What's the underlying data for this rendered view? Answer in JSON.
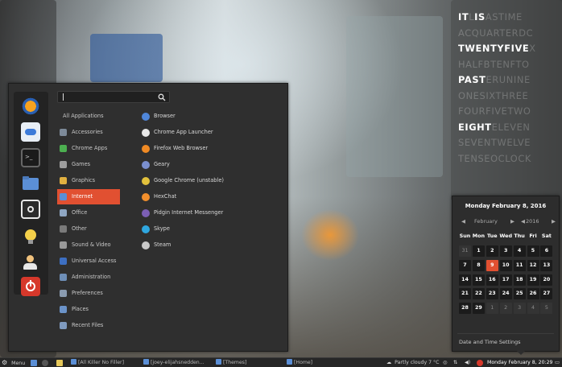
{
  "word_clock": {
    "rows": [
      [
        {
          "t": "IT",
          "on": true
        },
        {
          "t": "L",
          "on": false
        },
        {
          "t": "IS",
          "on": true
        },
        {
          "t": "ASTIME",
          "on": false
        }
      ],
      [
        {
          "t": "ACQUARTERDC",
          "on": false
        }
      ],
      [
        {
          "t": "TWENTYFIVE",
          "on": true
        },
        {
          "t": "X",
          "on": false
        }
      ],
      [
        {
          "t": "HALFBTENFTO",
          "on": false
        }
      ],
      [
        {
          "t": "PAST",
          "on": true
        },
        {
          "t": "ERUNINE",
          "on": false
        }
      ],
      [
        {
          "t": "ONESIXTHREE",
          "on": false
        }
      ],
      [
        {
          "t": "FOURFIVETWO",
          "on": false
        }
      ],
      [
        {
          "t": "EIGHT",
          "on": true
        },
        {
          "t": "ELEVEN",
          "on": false
        }
      ],
      [
        {
          "t": "SEVENTWELVE",
          "on": false
        }
      ],
      [
        {
          "t": "TENSEOCLOCK",
          "on": false
        }
      ]
    ]
  },
  "menu": {
    "search_placeholder": "",
    "favorites": [
      "firefox-icon",
      "settings-toggle-icon",
      "terminal-icon",
      "files-icon",
      "screenshot-icon",
      "lightbulb-icon",
      "user-logout-icon",
      "power-icon"
    ],
    "categories": [
      {
        "label": "All Applications",
        "icon": "none"
      },
      {
        "label": "Accessories",
        "icon": "accessories-icon"
      },
      {
        "label": "Chrome Apps",
        "icon": "chrome-apps-icon"
      },
      {
        "label": "Games",
        "icon": "games-icon"
      },
      {
        "label": "Graphics",
        "icon": "graphics-icon"
      },
      {
        "label": "Internet",
        "icon": "internet-icon"
      },
      {
        "label": "Office",
        "icon": "office-icon"
      },
      {
        "label": "Other",
        "icon": "other-icon"
      },
      {
        "label": "Sound & Video",
        "icon": "sound-video-icon"
      },
      {
        "label": "Universal Access",
        "icon": "universal-access-icon"
      },
      {
        "label": "Administration",
        "icon": "administration-icon"
      },
      {
        "label": "Preferences",
        "icon": "preferences-icon"
      },
      {
        "label": "Places",
        "icon": "places-icon"
      },
      {
        "label": "Recent Files",
        "icon": "recent-files-icon"
      }
    ],
    "selected_category": "Internet",
    "apps": [
      {
        "label": "Browser",
        "icon": "browser-icon"
      },
      {
        "label": "Chrome App Launcher",
        "icon": "chrome-app-launcher-icon"
      },
      {
        "label": "Firefox Web Browser",
        "icon": "firefox-icon"
      },
      {
        "label": "Geary",
        "icon": "geary-icon"
      },
      {
        "label": "Google Chrome (unstable)",
        "icon": "google-chrome-icon"
      },
      {
        "label": "HexChat",
        "icon": "hexchat-icon"
      },
      {
        "label": "Pidgin Internet Messenger",
        "icon": "pidgin-icon"
      },
      {
        "label": "Skype",
        "icon": "skype-icon"
      },
      {
        "label": "Steam",
        "icon": "steam-icon"
      }
    ]
  },
  "calendar": {
    "title": "Monday February  8, 2016",
    "month": "February",
    "year": "2016",
    "weekdays": [
      "Sun",
      "Mon",
      "Tue",
      "Wed",
      "Thu",
      "Fri",
      "Sat"
    ],
    "weeks": [
      [
        {
          "d": "31",
          "m": "o"
        },
        {
          "d": "1",
          "m": "c"
        },
        {
          "d": "2",
          "m": "c"
        },
        {
          "d": "3",
          "m": "c"
        },
        {
          "d": "4",
          "m": "c"
        },
        {
          "d": "5",
          "m": "c"
        },
        {
          "d": "6",
          "m": "c"
        }
      ],
      [
        {
          "d": "7",
          "m": "c"
        },
        {
          "d": "8",
          "m": "c"
        },
        {
          "d": "9",
          "m": "t"
        },
        {
          "d": "10",
          "m": "c"
        },
        {
          "d": "11",
          "m": "c"
        },
        {
          "d": "12",
          "m": "c"
        },
        {
          "d": "13",
          "m": "c"
        }
      ],
      [
        {
          "d": "14",
          "m": "c"
        },
        {
          "d": "15",
          "m": "c"
        },
        {
          "d": "16",
          "m": "c"
        },
        {
          "d": "17",
          "m": "c"
        },
        {
          "d": "18",
          "m": "c"
        },
        {
          "d": "19",
          "m": "c"
        },
        {
          "d": "20",
          "m": "c"
        }
      ],
      [
        {
          "d": "21",
          "m": "c"
        },
        {
          "d": "22",
          "m": "c"
        },
        {
          "d": "23",
          "m": "c"
        },
        {
          "d": "24",
          "m": "c"
        },
        {
          "d": "25",
          "m": "c"
        },
        {
          "d": "26",
          "m": "c"
        },
        {
          "d": "27",
          "m": "c"
        }
      ],
      [
        {
          "d": "28",
          "m": "c"
        },
        {
          "d": "29",
          "m": "c"
        },
        {
          "d": "1",
          "m": "o"
        },
        {
          "d": "2",
          "m": "o"
        },
        {
          "d": "3",
          "m": "o"
        },
        {
          "d": "4",
          "m": "o"
        },
        {
          "d": "5",
          "m": "o"
        }
      ]
    ],
    "settings_label": "Date and Time Settings"
  },
  "panel": {
    "menu_label": "Menu",
    "windows": [
      "[All Killer No Filler]",
      "[joey-elijahsnedden...",
      "[Themes]",
      "[Home]"
    ],
    "weather": "Partly cloudy 7 °C",
    "clock": "Monday February  8, 20:29"
  },
  "colors": {
    "accent": "#e15031",
    "menu_bg": "#2f2f2f",
    "panel_bg": "#262626"
  }
}
